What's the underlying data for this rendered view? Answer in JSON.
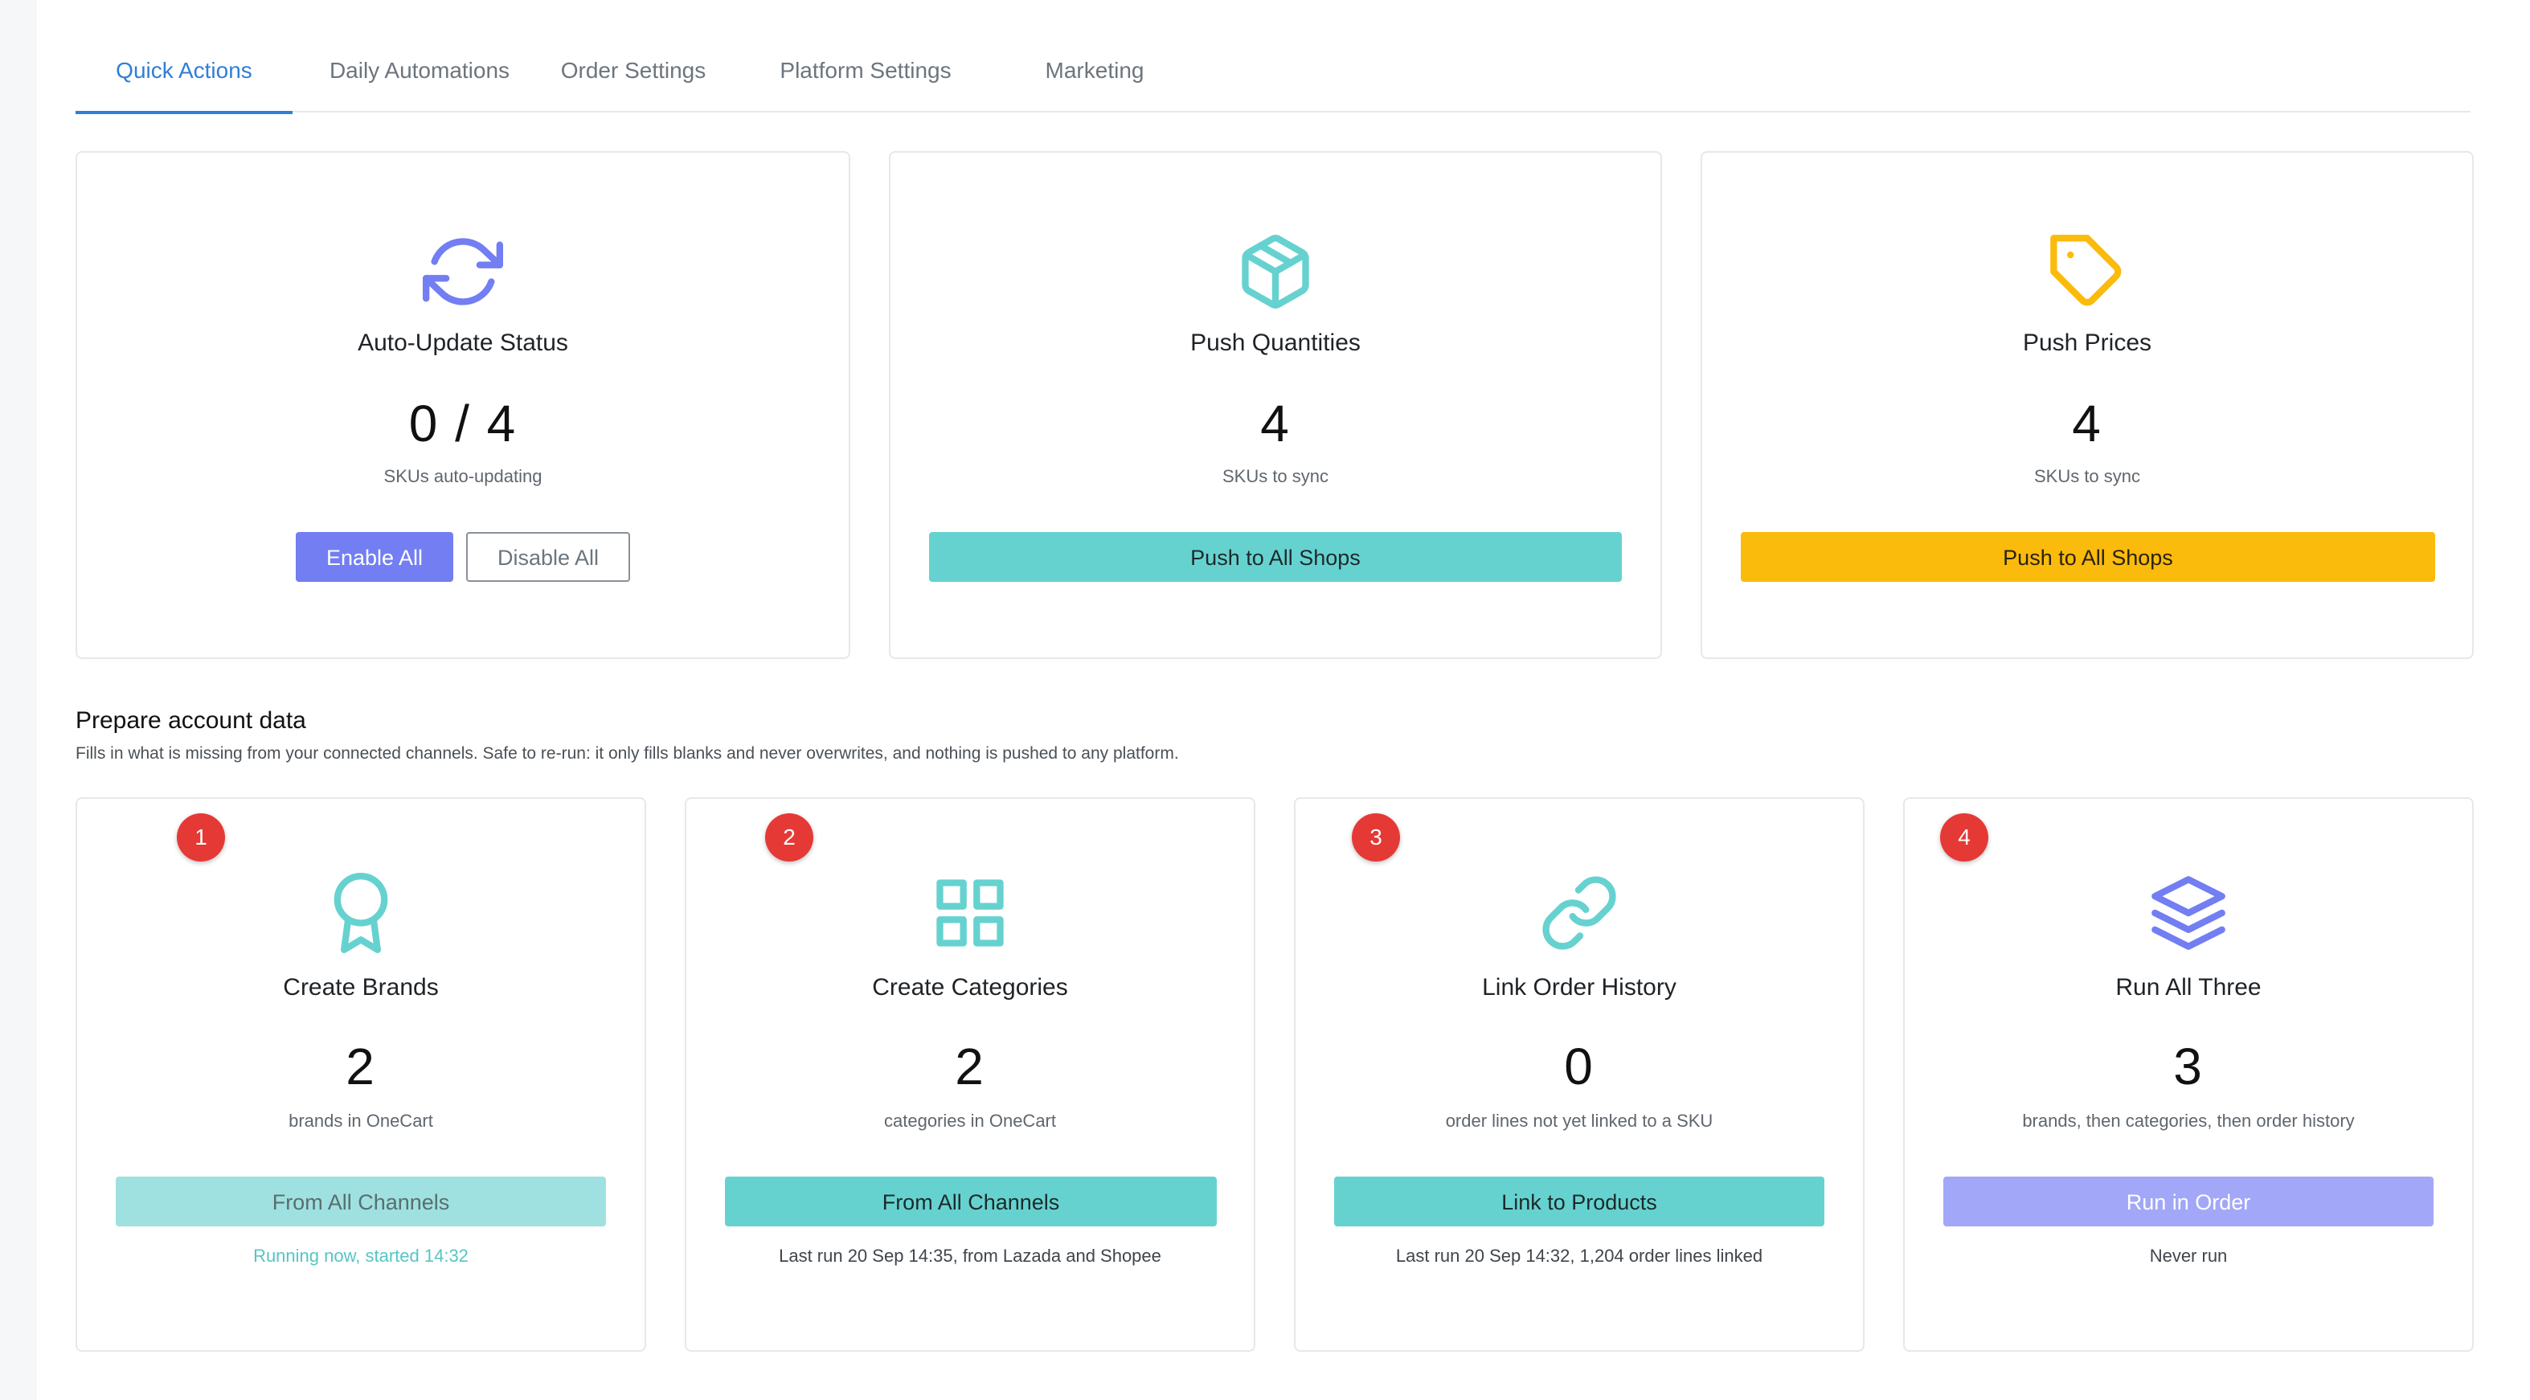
{
  "tabs": [
    {
      "label": "Quick Actions",
      "active": true
    },
    {
      "label": "Daily Automations",
      "active": false
    },
    {
      "label": "Order Settings",
      "active": false
    },
    {
      "label": "Platform Settings",
      "active": false
    },
    {
      "label": "Marketing",
      "active": false
    }
  ],
  "quick_cards": {
    "auto_update": {
      "icon": "refresh-icon",
      "title": "Auto-Update Status",
      "value": "0 / 4",
      "caption": "SKUs auto-updating",
      "enable_label": "Enable All",
      "disable_label": "Disable All"
    },
    "push_quantities": {
      "icon": "box-icon",
      "title": "Push Quantities",
      "value": "4",
      "caption": "SKUs to sync",
      "button_label": "Push to All Shops"
    },
    "push_prices": {
      "icon": "price-tag-icon",
      "title": "Push Prices",
      "value": "4",
      "caption": "SKUs to sync",
      "button_label": "Push to All Shops"
    }
  },
  "prepare": {
    "title": "Prepare account data",
    "description": "Fills in what is missing from your connected channels. Safe to re-run: it only fills blanks and never overwrites, and nothing is pushed to any platform.",
    "cards": [
      {
        "step": "1",
        "icon": "award-ribbon-icon",
        "title": "Create Brands",
        "value": "2",
        "caption": "brands in OneCart",
        "button_label": "From All Channels",
        "status": "Running now, started 14:32"
      },
      {
        "step": "2",
        "icon": "grid-icon",
        "title": "Create Categories",
        "value": "2",
        "caption": "categories in OneCart",
        "button_label": "From All Channels",
        "status": "Last run 20 Sep 14:35, from Lazada and Shopee"
      },
      {
        "step": "3",
        "icon": "link-icon",
        "title": "Link Order History",
        "value": "0",
        "caption": "order lines not yet linked to a SKU",
        "button_label": "Link to Products",
        "status": "Last run 20 Sep 14:32, 1,204 order lines linked"
      },
      {
        "step": "4",
        "icon": "layers-icon",
        "title": "Run All Three",
        "value": "3",
        "caption": "brands, then categories, then order history",
        "button_label": "Run in Order",
        "status": "Never run"
      }
    ]
  },
  "colors": {
    "accent_blue": "#2f7ed8",
    "purple": "#727ef2",
    "teal": "#66d2d0",
    "yellow": "#fbbb0c",
    "badge_red": "#e53935"
  }
}
